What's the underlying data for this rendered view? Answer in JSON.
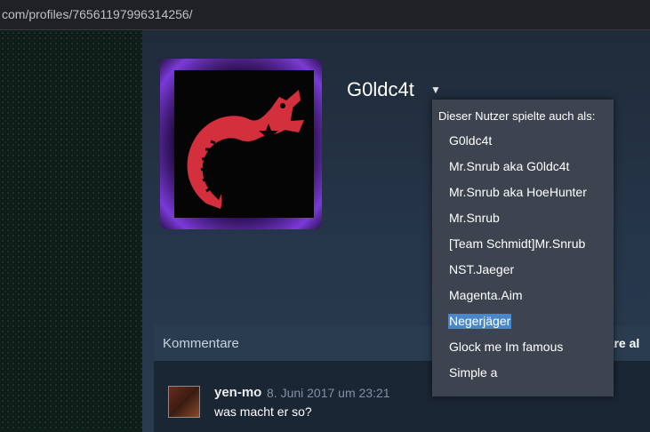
{
  "browser": {
    "url": "com/profiles/76561197996314256/"
  },
  "profile": {
    "persona_name": "G0ldc4t",
    "persona_dropdown_icon": "caret-down-icon",
    "avatar_icon": "snake-avatar-icon"
  },
  "alias_dropdown": {
    "header": "Dieser Nutzer spielte auch als:",
    "aliases": [
      "G0ldc4t",
      "Mr.Snrub aka G0ldc4t",
      "Mr.Snrub aka HoeHunter",
      "Mr.Snrub",
      "[Team Schmidt]Mr.Snrub",
      "NST.Jaeger",
      "Magenta.Aim",
      "Negerjäger",
      "Glock me Im famous",
      "Simple a"
    ],
    "selected_index": 7
  },
  "comments": {
    "title": "Kommentare",
    "right_text": "tare al",
    "items": [
      {
        "author": "yen-mo",
        "date": "8. Juni 2017 um 23:21",
        "text": "was macht er so?"
      }
    ]
  },
  "colors": {
    "page_background": "#1b2838",
    "dropdown_background": "#3d4450",
    "selection_highlight": "#4a87c7",
    "snake_red": "#d32f3d",
    "avatar_glow": "#7b3ad9"
  }
}
